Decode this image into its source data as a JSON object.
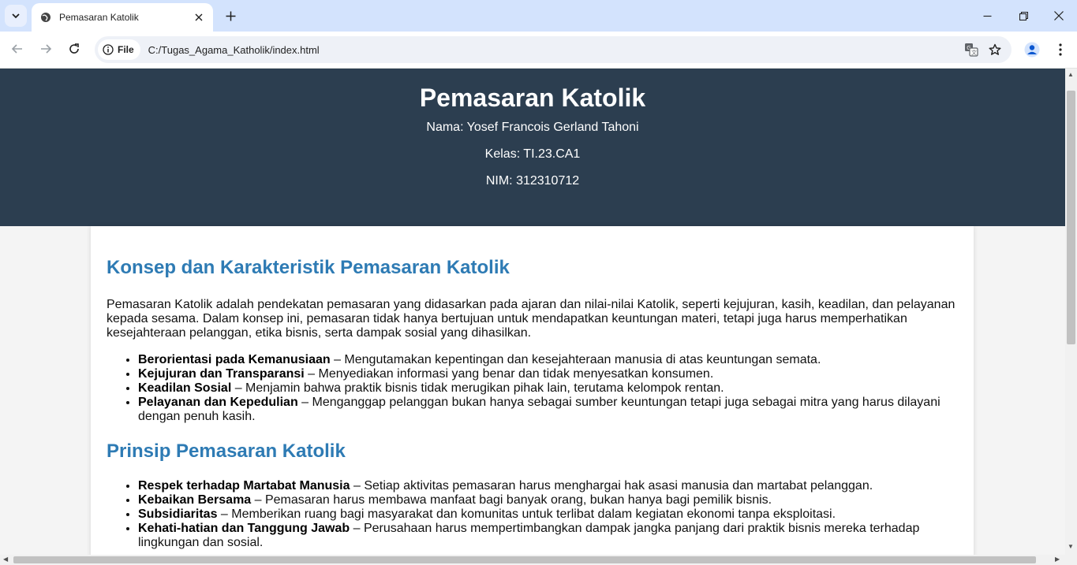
{
  "browser": {
    "tab_title": "Pemasaran Katolik",
    "site_chip_label": "File",
    "url": "C:/Tugas_Agama_Katholik/index.html"
  },
  "header": {
    "title": "Pemasaran Katolik",
    "nama": "Nama: Yosef Francois Gerland Tahoni",
    "kelas": "Kelas: TI.23.CA1",
    "nim": "NIM: 312310712"
  },
  "section1": {
    "heading": "Konsep dan Karakteristik Pemasaran Katolik",
    "paragraph": "Pemasaran Katolik adalah pendekatan pemasaran yang didasarkan pada ajaran dan nilai-nilai Katolik, seperti kejujuran, kasih, keadilan, dan pelayanan kepada sesama. Dalam konsep ini, pemasaran tidak hanya bertujuan untuk mendapatkan keuntungan materi, tetapi juga harus memperhatikan kesejahteraan pelanggan, etika bisnis, serta dampak sosial yang dihasilkan.",
    "items": [
      {
        "term": "Berorientasi pada Kemanusiaan",
        "desc": " – Mengutamakan kepentingan dan kesejahteraan manusia di atas keuntungan semata."
      },
      {
        "term": "Kejujuran dan Transparansi",
        "desc": " – Menyediakan informasi yang benar dan tidak menyesatkan konsumen."
      },
      {
        "term": "Keadilan Sosial",
        "desc": " – Menjamin bahwa praktik bisnis tidak merugikan pihak lain, terutama kelompok rentan."
      },
      {
        "term": "Pelayanan dan Kepedulian",
        "desc": " – Menganggap pelanggan bukan hanya sebagai sumber keuntungan tetapi juga sebagai mitra yang harus dilayani dengan penuh kasih."
      }
    ]
  },
  "section2": {
    "heading": "Prinsip Pemasaran Katolik",
    "items": [
      {
        "term": "Respek terhadap Martabat Manusia",
        "desc": " – Setiap aktivitas pemasaran harus menghargai hak asasi manusia dan martabat pelanggan."
      },
      {
        "term": "Kebaikan Bersama",
        "desc": " – Pemasaran harus membawa manfaat bagi banyak orang, bukan hanya bagi pemilik bisnis."
      },
      {
        "term": "Subsidiaritas",
        "desc": " – Memberikan ruang bagi masyarakat dan komunitas untuk terlibat dalam kegiatan ekonomi tanpa eksploitasi."
      },
      {
        "term": "Kehati-hatian dan Tanggung Jawab",
        "desc": " – Perusahaan harus mempertimbangkan dampak jangka panjang dari praktik bisnis mereka terhadap lingkungan dan sosial."
      }
    ]
  },
  "colors": {
    "header_bg": "#2c3e50",
    "heading_blue": "#2e7bb4",
    "tabstrip_bg": "#d3e3fd"
  },
  "icons": [
    "tab-search-icon",
    "globe-icon",
    "close-icon",
    "plus-icon",
    "minimize-icon",
    "restore-icon",
    "back-icon",
    "forward-icon",
    "reload-icon",
    "info-icon",
    "translate-icon",
    "star-icon",
    "profile-icon",
    "more-vert-icon"
  ]
}
